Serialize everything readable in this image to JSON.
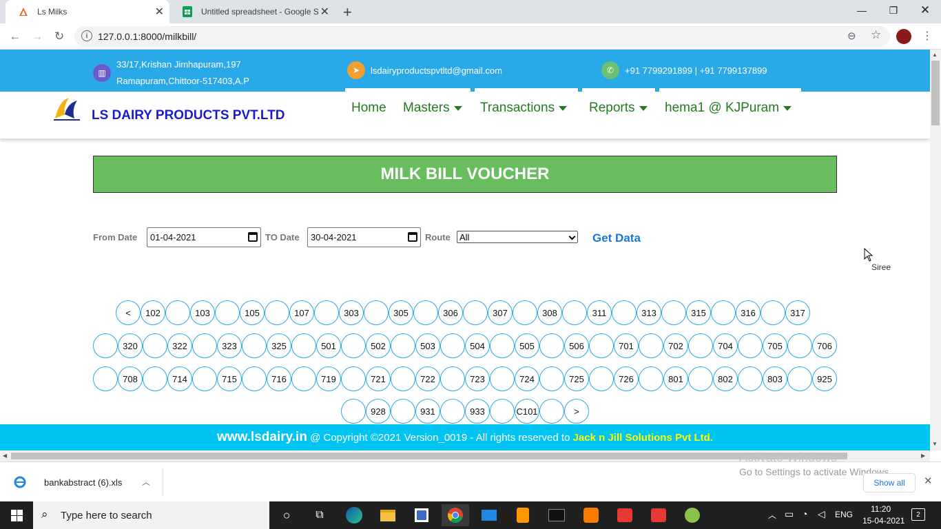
{
  "browser": {
    "tabs": [
      {
        "title": "Ls Milks"
      },
      {
        "title": "Untitled spreadsheet - Google Sh"
      }
    ],
    "url": "127.0.0.1:8000/milkbill/"
  },
  "contact": {
    "address_line1": "33/17,Krishan Jimhapuram,197",
    "address_line2": "Ramapuram,Chittoor-517403,A.P",
    "email": "lsdairyproductspvtltd@gmail.com",
    "phone": "+91 7799291899 | +91 7799137899"
  },
  "header": {
    "brand": "LS DAIRY PRODUCTS PVT.LTD",
    "menu": [
      {
        "label": "Home",
        "dropdown": false
      },
      {
        "label": "Masters",
        "dropdown": true
      },
      {
        "label": "Transactions",
        "dropdown": true
      },
      {
        "label": "Reports",
        "dropdown": true
      },
      {
        "label": "hema1 @ KJPuram",
        "dropdown": true
      }
    ]
  },
  "voucher": {
    "title": "MILK BILL VOUCHER"
  },
  "filters": {
    "from_label": "From Date",
    "from_value": "01-04-2021",
    "to_label": "TO Date",
    "to_value": "30-04-2021",
    "route_label": "Route",
    "route_value": "All",
    "get_data_label": "Get Data"
  },
  "cursor_tooltip": "Siree",
  "pager": {
    "row1": [
      "<",
      "102",
      "",
      "103",
      "",
      "105",
      "",
      "107",
      "",
      "303",
      "",
      "305",
      "",
      "306",
      "",
      "307",
      "",
      "308",
      "",
      "311",
      "",
      "313",
      "",
      "315",
      "",
      "316",
      "",
      "317"
    ],
    "row2": [
      "",
      "320",
      "",
      "322",
      "",
      "323",
      "",
      "325",
      "",
      "501",
      "",
      "502",
      "",
      "503",
      "",
      "504",
      "",
      "505",
      "",
      "506",
      "",
      "701",
      "",
      "702",
      "",
      "704",
      "",
      "705",
      "",
      "706"
    ],
    "row3": [
      "",
      "708",
      "",
      "714",
      "",
      "715",
      "",
      "716",
      "",
      "719",
      "",
      "721",
      "",
      "722",
      "",
      "723",
      "",
      "724",
      "",
      "725",
      "",
      "726",
      "",
      "801",
      "",
      "802",
      "",
      "803",
      "",
      "925"
    ],
    "row4": [
      "",
      "928",
      "",
      "931",
      "",
      "933",
      "",
      "C101",
      "",
      ">"
    ]
  },
  "footer": {
    "site": "www.lsdairy.in",
    "copyright": " @ Copyright ©2021 Version_0019 - All rights reserved to ",
    "company": "Jack n Jill Solutions Pvt Ltd."
  },
  "download": {
    "filename": "bankabstract (6).xls",
    "show_all": "Show all"
  },
  "watermark": {
    "line1": "Activate Windows",
    "line2": "Go to Settings to activate Windows."
  },
  "taskbar": {
    "search_placeholder": "Type here to search",
    "lang": "ENG",
    "time": "11:20",
    "date": "15-04-2021",
    "notification_count": "2"
  },
  "colors": {
    "top_strip": "#29a9e8",
    "voucher_bg": "#68bd5e",
    "footer_bg": "#00c5f3",
    "brand": "#1a1ad0",
    "menu": "#237a23",
    "footer_company": "#ffff00"
  }
}
